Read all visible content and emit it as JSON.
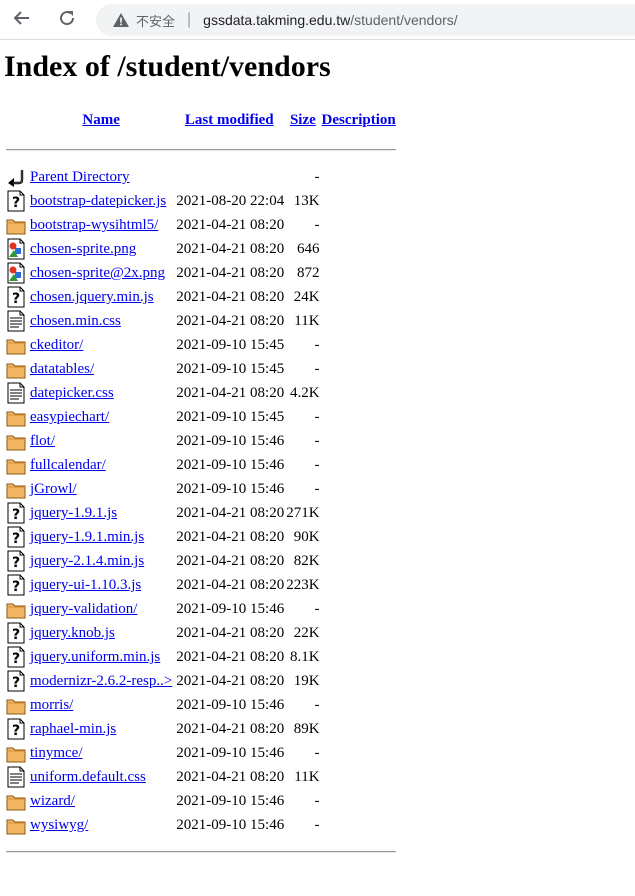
{
  "browser": {
    "insecure_label": "不安全",
    "url_host": "gssdata.takming.edu.tw",
    "url_path": "/student/vendors/"
  },
  "page": {
    "title": "Index of /student/vendors"
  },
  "table": {
    "headers": {
      "name": "Name",
      "last_modified": "Last modified",
      "size": "Size",
      "description": "Description"
    },
    "rows": [
      {
        "icon": "back",
        "name": "Parent Directory",
        "date": "",
        "size": "-"
      },
      {
        "icon": "unknown",
        "name": "bootstrap-datepicker.js",
        "date": "2021-08-20 22:04",
        "size": "13K"
      },
      {
        "icon": "folder",
        "name": "bootstrap-wysihtml5/",
        "date": "2021-04-21 08:20",
        "size": "-"
      },
      {
        "icon": "image",
        "name": "chosen-sprite.png",
        "date": "2021-04-21 08:20",
        "size": "646"
      },
      {
        "icon": "image",
        "name": "chosen-sprite@2x.png",
        "date": "2021-04-21 08:20",
        "size": "872"
      },
      {
        "icon": "unknown",
        "name": "chosen.jquery.min.js",
        "date": "2021-04-21 08:20",
        "size": "24K"
      },
      {
        "icon": "text",
        "name": "chosen.min.css",
        "date": "2021-04-21 08:20",
        "size": "11K"
      },
      {
        "icon": "folder",
        "name": "ckeditor/",
        "date": "2021-09-10 15:45",
        "size": "-"
      },
      {
        "icon": "folder",
        "name": "datatables/",
        "date": "2021-09-10 15:45",
        "size": "-"
      },
      {
        "icon": "text",
        "name": "datepicker.css",
        "date": "2021-04-21 08:20",
        "size": "4.2K"
      },
      {
        "icon": "folder",
        "name": "easypiechart/",
        "date": "2021-09-10 15:45",
        "size": "-"
      },
      {
        "icon": "folder",
        "name": "flot/",
        "date": "2021-09-10 15:46",
        "size": "-"
      },
      {
        "icon": "folder",
        "name": "fullcalendar/",
        "date": "2021-09-10 15:46",
        "size": "-"
      },
      {
        "icon": "folder",
        "name": "jGrowl/",
        "date": "2021-09-10 15:46",
        "size": "-"
      },
      {
        "icon": "unknown",
        "name": "jquery-1.9.1.js",
        "date": "2021-04-21 08:20",
        "size": "271K"
      },
      {
        "icon": "unknown",
        "name": "jquery-1.9.1.min.js",
        "date": "2021-04-21 08:20",
        "size": "90K"
      },
      {
        "icon": "unknown",
        "name": "jquery-2.1.4.min.js",
        "date": "2021-04-21 08:20",
        "size": "82K"
      },
      {
        "icon": "unknown",
        "name": "jquery-ui-1.10.3.js",
        "date": "2021-04-21 08:20",
        "size": "223K"
      },
      {
        "icon": "folder",
        "name": "jquery-validation/",
        "date": "2021-09-10 15:46",
        "size": "-"
      },
      {
        "icon": "unknown",
        "name": "jquery.knob.js",
        "date": "2021-04-21 08:20",
        "size": "22K"
      },
      {
        "icon": "unknown",
        "name": "jquery.uniform.min.js",
        "date": "2021-04-21 08:20",
        "size": "8.1K"
      },
      {
        "icon": "unknown",
        "name": "modernizr-2.6.2-resp..>",
        "date": "2021-04-21 08:20",
        "size": "19K"
      },
      {
        "icon": "folder",
        "name": "morris/",
        "date": "2021-09-10 15:46",
        "size": "-"
      },
      {
        "icon": "unknown",
        "name": "raphael-min.js",
        "date": "2021-04-21 08:20",
        "size": "89K"
      },
      {
        "icon": "folder",
        "name": "tinymce/",
        "date": "2021-09-10 15:46",
        "size": "-"
      },
      {
        "icon": "text",
        "name": "uniform.default.css",
        "date": "2021-04-21 08:20",
        "size": "11K"
      },
      {
        "icon": "folder",
        "name": "wizard/",
        "date": "2021-09-10 15:46",
        "size": "-"
      },
      {
        "icon": "folder",
        "name": "wysiwyg/",
        "date": "2021-09-10 15:46",
        "size": "-"
      }
    ]
  }
}
